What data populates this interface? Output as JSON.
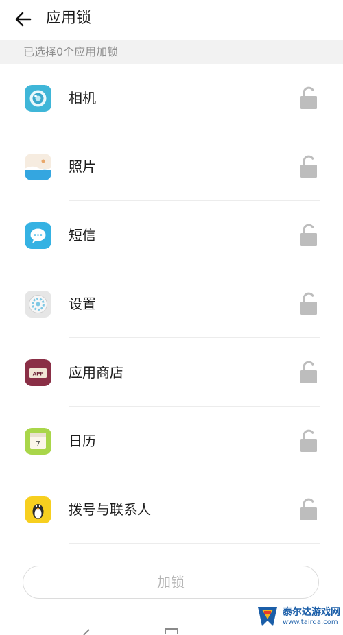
{
  "header": {
    "title": "应用锁"
  },
  "summary": {
    "text": "已选择0个应用加锁"
  },
  "apps": [
    {
      "label": "相机",
      "icon": "camera-icon"
    },
    {
      "label": "照片",
      "icon": "photos-icon"
    },
    {
      "label": "短信",
      "icon": "messages-icon"
    },
    {
      "label": "设置",
      "icon": "settings-icon"
    },
    {
      "label": "应用商店",
      "icon": "app-store-icon"
    },
    {
      "label": "日历",
      "icon": "calendar-icon"
    },
    {
      "label": "拨号与联系人",
      "icon": "dialer-contacts-icon"
    }
  ],
  "footer": {
    "button_label": "加锁"
  },
  "watermark": {
    "name": "泰尔达游戏网",
    "url": "www.tairda.com"
  },
  "colors": {
    "lock_grey": "#bdbdbd",
    "subbar_bg": "#f2f2f2"
  }
}
